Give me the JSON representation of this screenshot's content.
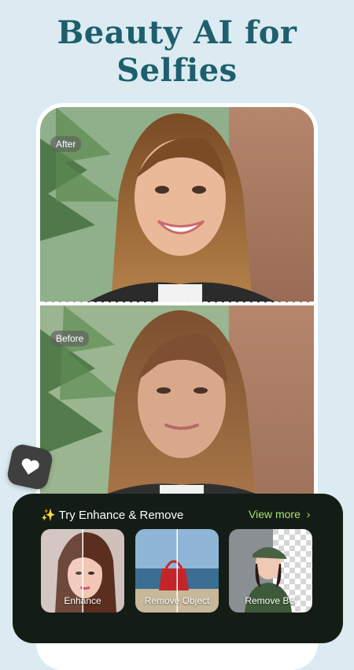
{
  "headline": {
    "line1": "Beauty AI for",
    "line2": "Selfies"
  },
  "comparison": {
    "after_label": "After",
    "before_label": "Before"
  },
  "app_icon": "heart-icon",
  "panel": {
    "sparkle_icon": "✨",
    "title": "Try Enhance & Remove",
    "view_more": "View more",
    "cards": [
      {
        "label": "Enhance"
      },
      {
        "label": "Remove Object"
      },
      {
        "label": "Remove BG"
      }
    ]
  },
  "colors": {
    "background": "#dcebf1",
    "headline": "#1e5f6d",
    "panel": "#141c16",
    "accent": "#a8e36a"
  }
}
